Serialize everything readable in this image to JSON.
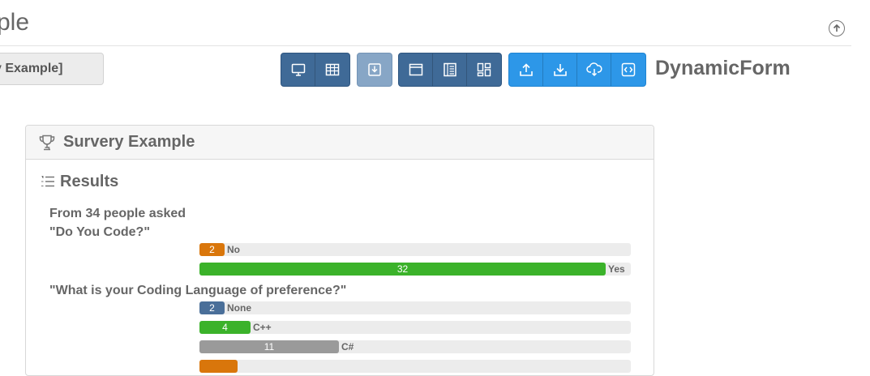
{
  "header": {
    "title": "ple",
    "breadcrumb_label": "y Example]",
    "dynamic_label": "DynamicForm"
  },
  "toolbar": {
    "groups": [
      {
        "style": "dark",
        "buttons": [
          "monitor-icon",
          "table-icon"
        ]
      },
      {
        "style": "light",
        "buttons": [
          "download-box-icon"
        ]
      },
      {
        "style": "dark",
        "buttons": [
          "window-icon",
          "list-panel-icon",
          "dashboard-icon"
        ]
      },
      {
        "style": "blue",
        "buttons": [
          "upload-icon",
          "download-icon",
          "cloud-download-icon",
          "code-icon"
        ]
      }
    ]
  },
  "panel": {
    "title": "Survery Example",
    "results_title": "Results",
    "intro": "From 34 people asked",
    "total": 34
  },
  "questions": [
    {
      "text": "\"Do You Code?\"",
      "answers": [
        {
          "label": "No",
          "count": 2,
          "color": "#d9760b"
        },
        {
          "label": "Yes",
          "count": 32,
          "color": "#3bb22a"
        }
      ]
    },
    {
      "text": "\"What is your Coding Language of preference?\"",
      "answers": [
        {
          "label": "None",
          "count": 2,
          "color": "#4a6f99"
        },
        {
          "label": "C++",
          "count": 4,
          "color": "#3bb22a"
        },
        {
          "label": "C#",
          "count": 11,
          "color": "#9a9a9a"
        },
        {
          "label": "",
          "count": null,
          "color": "#d9760b"
        }
      ]
    }
  ],
  "colors": {
    "toolbar_dark": "#3f6a97",
    "toolbar_light": "#87a6c6",
    "toolbar_blue": "#2d97e8"
  }
}
